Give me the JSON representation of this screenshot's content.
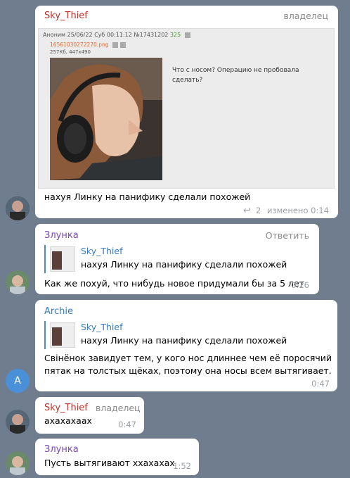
{
  "messages": {
    "m1": {
      "author": "Sky_Thief",
      "role": "владелец",
      "screenshot": {
        "header_prefix": "Аноним 25/06/22 Суб 00:11:12 №17431202",
        "replies_count": "325",
        "filename": "16561030272270.png",
        "file_meta": "257Кб, 447x490",
        "question": "Что с носом? Операцию не пробовала сделать?"
      },
      "text": "нахуя Линку на панифику сделали похожей",
      "reply_icon": "reply-arrow-icon",
      "reply_count": "2",
      "edited_time": "изменено 0:14"
    },
    "m2": {
      "author": "Злунка",
      "action": "Ответить",
      "reply_author": "Sky_Thief",
      "reply_text": "нахуя Линку на панифику сделали похожей",
      "text": "Как же похуй, что нибудь новое придумали бы за 5 лет",
      "time": "0:26"
    },
    "m3": {
      "author": "Archie",
      "avatar_letter": "A",
      "reply_author": "Sky_Thief",
      "reply_text": "нахуя Линку на панифику сделали похожей",
      "text_line1": "Свiнёнок завидует тем, у кого нос длиннее чем её поросячий",
      "text_line2": "пятак на толстых щёках, поэтому она носы всем вытягивает.",
      "time": "0:47"
    },
    "m4": {
      "author": "Sky_Thief",
      "role": "владелец",
      "text": "ахахахаах",
      "time": "0:47"
    },
    "m5": {
      "author": "Злунка",
      "text": "Пусть вытягивают ххахахах",
      "time": "1:52"
    }
  },
  "colors": {
    "background": "#6f7d8e",
    "owner_name": "#c4302b",
    "member_name": "#7a44c0",
    "archie_name": "#3a7bbf",
    "archie_avatar": "#4a90d9"
  }
}
